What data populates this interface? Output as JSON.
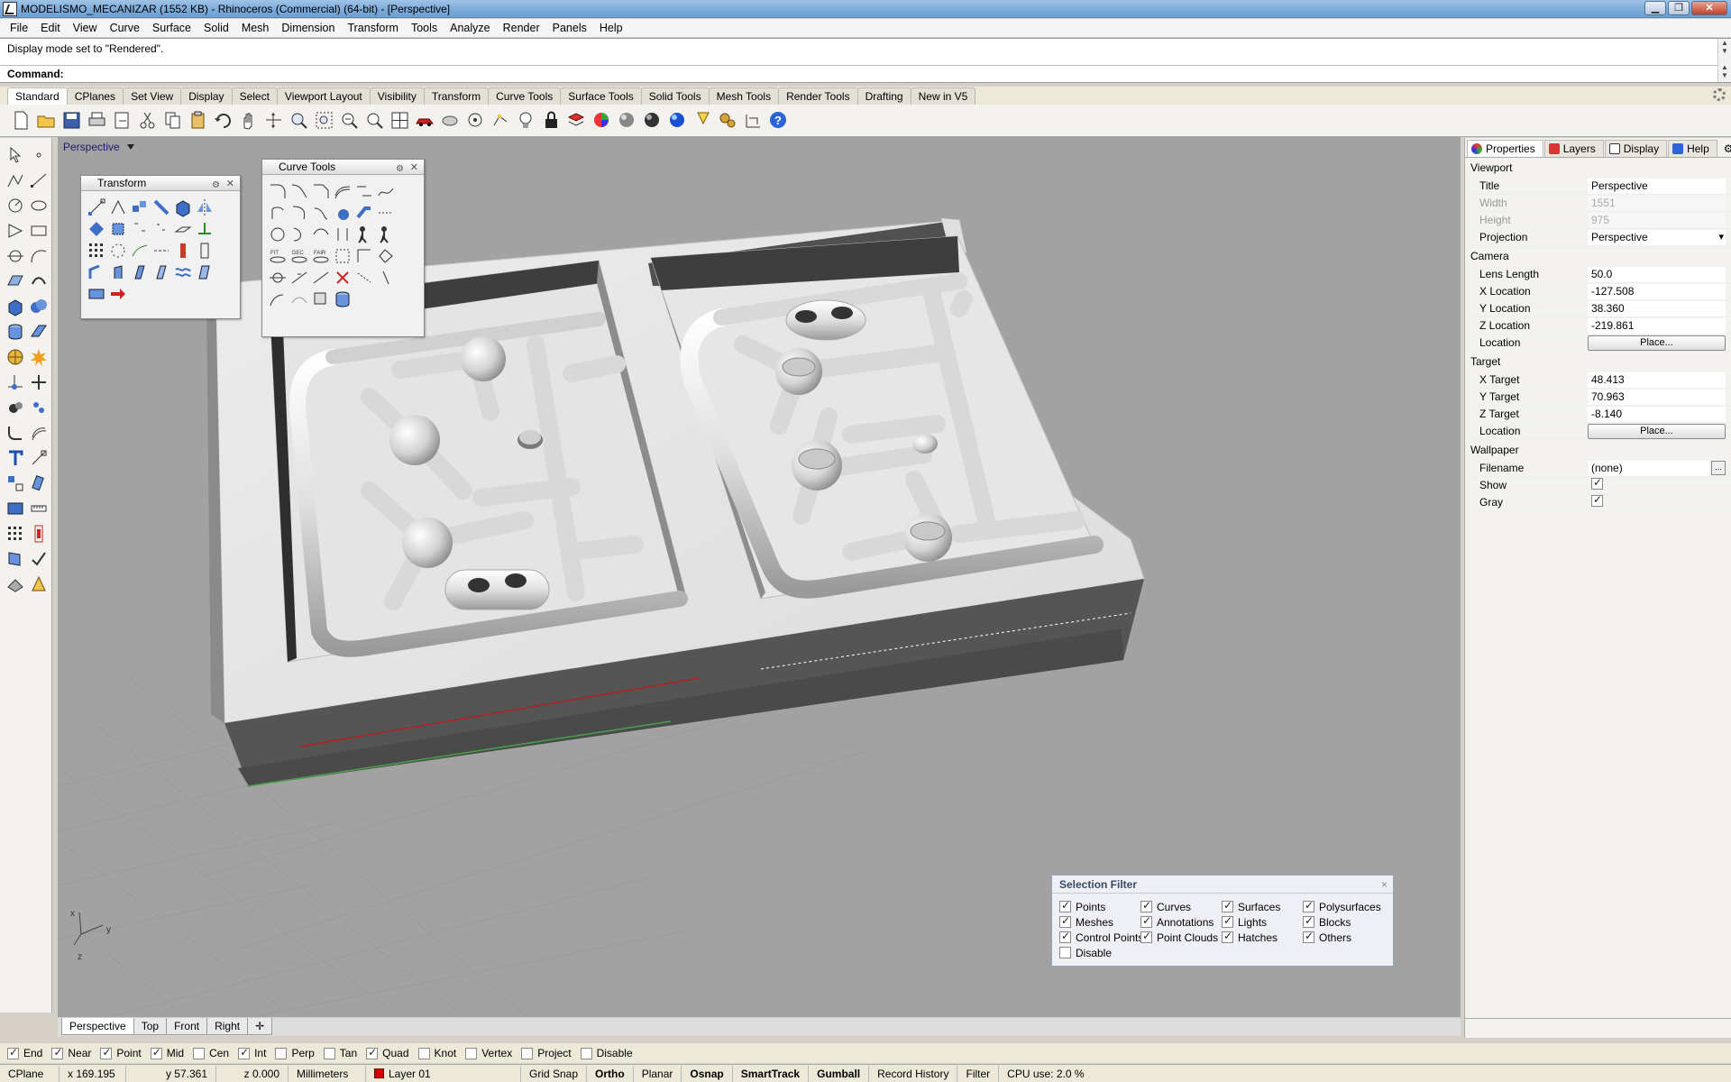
{
  "window": {
    "title": "MODELISMO_MECANIZAR (1552 KB) - Rhinoceros (Commercial) (64-bit) - [Perspective]"
  },
  "menu": [
    "File",
    "Edit",
    "View",
    "Curve",
    "Surface",
    "Solid",
    "Mesh",
    "Dimension",
    "Transform",
    "Tools",
    "Analyze",
    "Render",
    "Panels",
    "Help"
  ],
  "command": {
    "history": "Display mode set to \"Rendered\".",
    "prompt": "Command:"
  },
  "toolbar_tabs": [
    "Standard",
    "CPlanes",
    "Set View",
    "Display",
    "Select",
    "Viewport Layout",
    "Visibility",
    "Transform",
    "Curve Tools",
    "Surface Tools",
    "Solid Tools",
    "Mesh Tools",
    "Render Tools",
    "Drafting",
    "New in V5"
  ],
  "viewport": {
    "title": "Perspective",
    "axes": {
      "x": "x",
      "y": "y",
      "z": "z"
    }
  },
  "panels": {
    "transform": "Transform",
    "curve_tools": "Curve Tools"
  },
  "viewport_tabs": [
    "Perspective",
    "Top",
    "Front",
    "Right"
  ],
  "osnaps": [
    {
      "label": "End",
      "on": true
    },
    {
      "label": "Near",
      "on": true
    },
    {
      "label": "Point",
      "on": true
    },
    {
      "label": "Mid",
      "on": true
    },
    {
      "label": "Cen",
      "on": false
    },
    {
      "label": "Int",
      "on": true
    },
    {
      "label": "Perp",
      "on": false
    },
    {
      "label": "Tan",
      "on": false
    },
    {
      "label": "Quad",
      "on": true
    },
    {
      "label": "Knot",
      "on": false
    },
    {
      "label": "Vertex",
      "on": false
    },
    {
      "label": "Project",
      "on": false
    },
    {
      "label": "Disable",
      "on": false
    }
  ],
  "status": {
    "cplane": "CPlane",
    "x": "x 169.195",
    "y": "y 57.361",
    "z": "z 0.000",
    "units": "Millimeters",
    "layer": "Layer 01",
    "layer_color": "#d40000",
    "toggles": [
      "Grid Snap",
      "Ortho",
      "Planar",
      "Osnap",
      "SmartTrack",
      "Gumball",
      "Record History",
      "Filter"
    ],
    "cpu": "CPU use: 2.0 %"
  },
  "properties": {
    "tabs": [
      "Properties",
      "Layers",
      "Display",
      "Help"
    ],
    "viewport_section": "Viewport",
    "viewport_rows": [
      {
        "k": "Title",
        "v": "Perspective"
      },
      {
        "k": "Width",
        "v": "1551",
        "dim": true
      },
      {
        "k": "Height",
        "v": "975",
        "dim": true
      },
      {
        "k": "Projection",
        "v": "Perspective"
      }
    ],
    "camera_section": "Camera",
    "camera_rows": [
      {
        "k": "Lens Length",
        "v": "50.0"
      },
      {
        "k": "X Location",
        "v": "-127.508"
      },
      {
        "k": "Y Location",
        "v": "38.360"
      },
      {
        "k": "Z Location",
        "v": "-219.861"
      },
      {
        "k": "Location",
        "v": "Place..."
      }
    ],
    "target_section": "Target",
    "target_rows": [
      {
        "k": "X Target",
        "v": "48.413"
      },
      {
        "k": "Y Target",
        "v": "70.963"
      },
      {
        "k": "Z Target",
        "v": "-8.140"
      },
      {
        "k": "Location",
        "v": "Place..."
      }
    ],
    "wallpaper_section": "Wallpaper",
    "wallpaper_rows": [
      {
        "k": "Filename",
        "v": "(none)"
      },
      {
        "k": "Show",
        "on": true
      },
      {
        "k": "Gray",
        "on": true
      }
    ]
  },
  "selection_filter": {
    "title": "Selection Filter",
    "columns": [
      [
        {
          "label": "Points",
          "on": true
        },
        {
          "label": "Meshes",
          "on": true
        },
        {
          "label": "Control Points",
          "on": true
        },
        {
          "label": "Disable",
          "on": false
        }
      ],
      [
        {
          "label": "Curves",
          "on": true
        },
        {
          "label": "Annotations",
          "on": true
        },
        {
          "label": "Point Clouds",
          "on": true
        }
      ],
      [
        {
          "label": "Surfaces",
          "on": true
        },
        {
          "label": "Lights",
          "on": true
        },
        {
          "label": "Hatches",
          "on": true
        }
      ],
      [
        {
          "label": "Polysurfaces",
          "on": true
        },
        {
          "label": "Blocks",
          "on": true
        },
        {
          "label": "Others",
          "on": true
        }
      ]
    ]
  }
}
